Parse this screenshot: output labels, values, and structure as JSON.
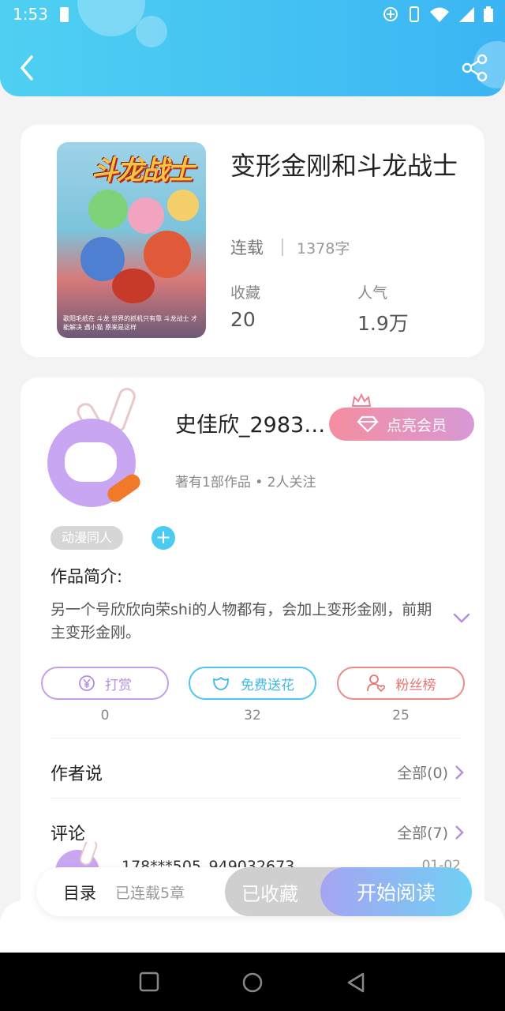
{
  "status_bar": {
    "time": "1:53"
  },
  "book": {
    "title": "变形金刚和斗龙战士",
    "status": "连载",
    "word_count": "1378字",
    "stats": [
      {
        "label": "收藏",
        "value": "20"
      },
      {
        "label": "人气",
        "value": "1.9万"
      }
    ],
    "cover_title": "斗龙战士6",
    "cover_caption": "歌阳毛纸在 斗龙 世界的抓机只有靠 斗龙战士 才能解决 遇小猫 原来是这样"
  },
  "author": {
    "name": "史佳欣_2983…",
    "vip_label": "点亮会员",
    "meta": "著有1部作品 • 2人关注",
    "tag": "动漫同人",
    "add_tag": "+"
  },
  "intro": {
    "title": "作品简介:",
    "text": "另一个号欣欣向荣shi的人物都有，会加上变形金刚，前期主变形金刚。"
  },
  "actions": [
    {
      "label": "打赏",
      "count": "0",
      "color": "#c79ee8",
      "icon": "yen-icon"
    },
    {
      "label": "免费送花",
      "count": "32",
      "color": "#52c7ee",
      "icon": "flower-icon"
    },
    {
      "label": "粉丝榜",
      "count": "25",
      "color": "#ee8a8a",
      "icon": "fan-icon"
    }
  ],
  "sections": {
    "author_says": {
      "title": "作者说",
      "link": "全部(0)"
    },
    "comments": {
      "title": "评论",
      "link": "全部(7)"
    },
    "comment_preview_user": "178***505_949032673",
    "comment_preview_date": "01-02"
  },
  "bottom_bar": {
    "toc": "目录",
    "toc_sub": "已连载5章",
    "collected": "已收藏",
    "read": "开始阅读"
  },
  "colors": {
    "header_gradient_start": "#4fd0f2",
    "header_gradient_end": "#3bb5f3",
    "accent_purple": "#c79ee8",
    "accent_blue": "#52c7ee",
    "accent_pink": "#ee8a8a"
  }
}
